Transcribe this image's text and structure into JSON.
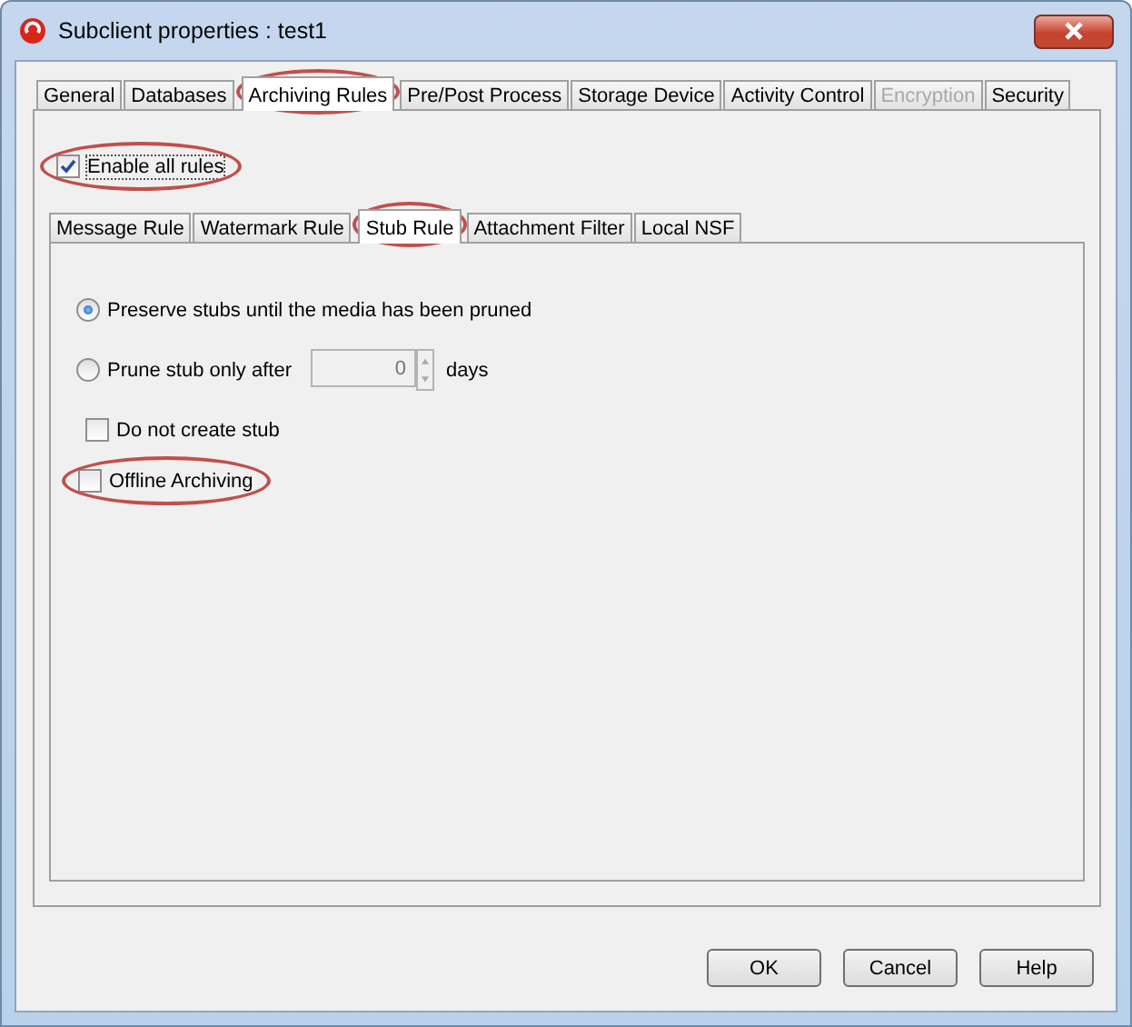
{
  "window": {
    "title": "Subclient properties : test1"
  },
  "tabs": [
    {
      "label": "General",
      "selected": false,
      "disabled": false,
      "highlighted": false
    },
    {
      "label": "Databases",
      "selected": false,
      "disabled": false,
      "highlighted": false
    },
    {
      "label": "Archiving Rules",
      "selected": true,
      "disabled": false,
      "highlighted": true
    },
    {
      "label": "Pre/Post Process",
      "selected": false,
      "disabled": false,
      "highlighted": false
    },
    {
      "label": "Storage Device",
      "selected": false,
      "disabled": false,
      "highlighted": false
    },
    {
      "label": "Activity Control",
      "selected": false,
      "disabled": false,
      "highlighted": false
    },
    {
      "label": "Encryption",
      "selected": false,
      "disabled": true,
      "highlighted": false
    },
    {
      "label": "Security",
      "selected": false,
      "disabled": false,
      "highlighted": false
    }
  ],
  "enable_all_rules": {
    "label": "Enable all rules",
    "checked": true,
    "highlighted": true
  },
  "subtabs": [
    {
      "label": "Message Rule",
      "selected": false,
      "highlighted": false
    },
    {
      "label": "Watermark Rule",
      "selected": false,
      "highlighted": false
    },
    {
      "label": "Stub Rule",
      "selected": true,
      "highlighted": true
    },
    {
      "label": "Attachment Filter",
      "selected": false,
      "highlighted": false
    },
    {
      "label": "Local NSF",
      "selected": false,
      "highlighted": false
    }
  ],
  "options": [
    {
      "kind": "radio",
      "label": "Preserve stubs until the media has been pruned",
      "selected": true
    },
    {
      "kind": "radio",
      "label": "Prune stub only after",
      "selected": false,
      "spinner": {
        "value": "0"
      },
      "suffix": "days"
    },
    {
      "kind": "checkbox",
      "label": "Do not create stub",
      "checked": false,
      "highlighted": false
    },
    {
      "kind": "checkbox",
      "label": "Offline Archiving",
      "checked": false,
      "highlighted": true
    }
  ],
  "buttons": [
    "OK",
    "Cancel",
    "Help"
  ]
}
